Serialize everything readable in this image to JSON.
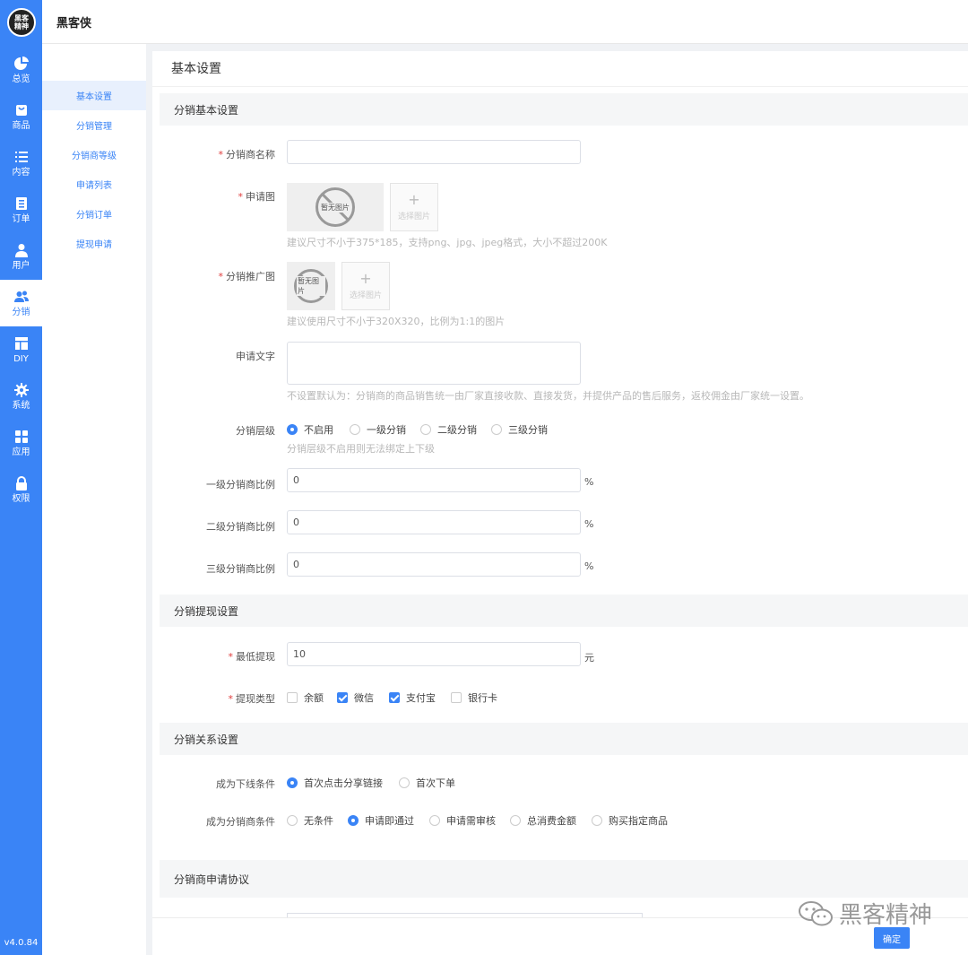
{
  "app": {
    "logo_line1": "黑客",
    "logo_line2": "精神",
    "title": "黑客侠",
    "version": "v4.0.84"
  },
  "rail": [
    {
      "label": "总览",
      "icon": "pie-chart-icon"
    },
    {
      "label": "商品",
      "icon": "bag-icon"
    },
    {
      "label": "内容",
      "icon": "list-icon"
    },
    {
      "label": "订单",
      "icon": "document-icon"
    },
    {
      "label": "用户",
      "icon": "user-icon"
    },
    {
      "label": "分销",
      "icon": "users-icon"
    },
    {
      "label": "DIY",
      "icon": "layout-icon"
    },
    {
      "label": "系统",
      "icon": "gear-icon"
    },
    {
      "label": "应用",
      "icon": "grid-icon"
    },
    {
      "label": "权限",
      "icon": "lock-icon"
    }
  ],
  "subnav": [
    "基本设置",
    "分销管理",
    "分销商等级",
    "申请列表",
    "分销订单",
    "提现申请"
  ],
  "page_title": "基本设置",
  "sections": {
    "basic": "分销基本设置",
    "withdraw": "分销提现设置",
    "relation": "分销关系设置",
    "agreement": "分销商申请协议"
  },
  "fields": {
    "name_label": "分销商名称",
    "name_value": "",
    "apply_img_label": "申请图",
    "no_image": "暂无图片",
    "choose_image": "选择图片",
    "apply_img_hint": "建议尺寸不小于375*185，支持png、jpg、jpeg格式，大小不超过200K",
    "promo_img_label": "分销推广图",
    "promo_img_hint": "建议使用尺寸不小于320X320，比例为1:1的图片",
    "apply_text_label": "申请文字",
    "apply_text_hint": "不设置默认为：分销商的商品销售统一由厂家直接收款、直接发货，并提供产品的售后服务，返校佣金由厂家统一设置。",
    "level_label": "分销层级",
    "level_options": [
      "不启用",
      "一级分销",
      "二级分销",
      "三级分销"
    ],
    "level_selected": 0,
    "level_hint": "分销层级不启用则无法绑定上下级",
    "ratio1_label": "一级分销商比例",
    "ratio1_value": "0",
    "ratio2_label": "二级分销商比例",
    "ratio2_value": "0",
    "ratio3_label": "三级分销商比例",
    "ratio3_value": "0",
    "percent": "%",
    "min_withdraw_label": "最低提现",
    "min_withdraw_value": "10",
    "yuan": "元",
    "withdraw_type_label": "提现类型",
    "withdraw_types": [
      {
        "label": "余额",
        "checked": false
      },
      {
        "label": "微信",
        "checked": true
      },
      {
        "label": "支付宝",
        "checked": true
      },
      {
        "label": "银行卡",
        "checked": false
      }
    ],
    "downline_label": "成为下线条件",
    "downline_options": [
      "首次点击分享链接",
      "首次下单"
    ],
    "downline_selected": 0,
    "become_label": "成为分销商条件",
    "become_options": [
      "无条件",
      "申请即通过",
      "申请需审核",
      "总消费金额",
      "购买指定商品"
    ],
    "become_selected": 1
  },
  "ok_button": "确定",
  "watermark": "黑客精神",
  "colors": {
    "primary": "#3a84f6",
    "required": "#e03c3c"
  }
}
